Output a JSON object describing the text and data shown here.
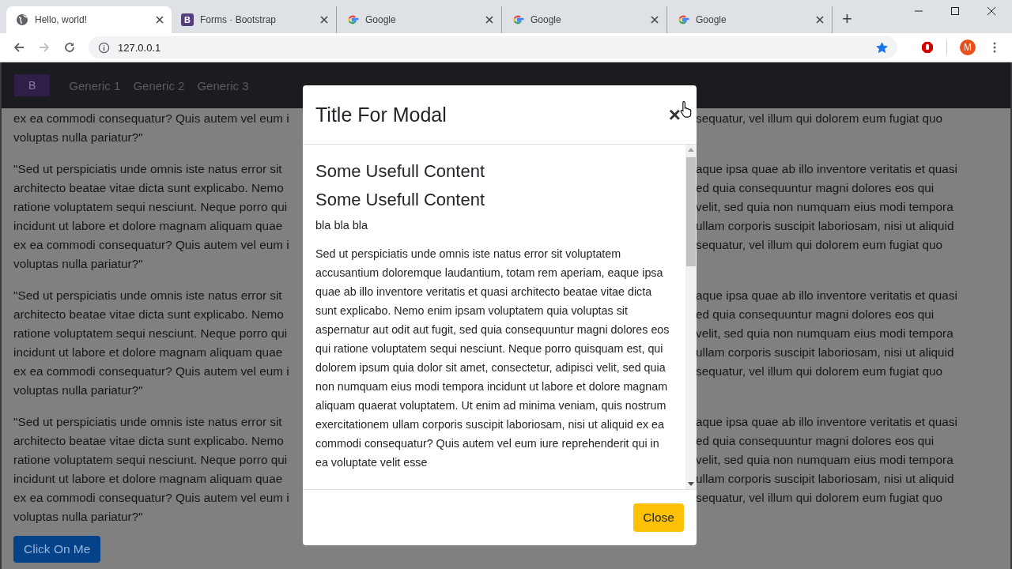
{
  "browser": {
    "tabs": [
      {
        "title": "Hello, world!",
        "kind": "globe",
        "selected": true
      },
      {
        "title": "Forms · Bootstrap",
        "kind": "letter",
        "icon_letter": "B",
        "selected": false
      },
      {
        "title": "Google",
        "kind": "google",
        "selected": false
      },
      {
        "title": "Google",
        "kind": "google",
        "selected": false
      },
      {
        "title": "Google",
        "kind": "google",
        "selected": false
      }
    ],
    "new_tab": "+",
    "address": "127.0.0.1",
    "bookmarked": true,
    "avatar": "M"
  },
  "navbar": {
    "brand": "B",
    "links": [
      "Generic 1",
      "Generic 2",
      "Generic 3"
    ]
  },
  "background": {
    "paragraphs": [
      {
        "lines": [
          {
            "left": "ex ea commodi consequatur? Quis autem vel eum i",
            "right": "sequatur, vel illum qui dolorem eum fugiat quo"
          },
          {
            "left": "voluptas nulla pariatur?\""
          }
        ]
      },
      {
        "lines": [
          {
            "left": "\"Sed ut perspiciatis unde omnis iste natus error sit",
            "right": "aque ipsa quae ab illo inventore veritatis et quasi"
          },
          {
            "left": "architecto beatae vitae dicta sunt explicabo. Nemo",
            "right": "ed quia consequuntur magni dolores eos qui"
          },
          {
            "left": "ratione voluptatem sequi nesciunt. Neque porro qui",
            "right": "velit, sed quia non numquam eius modi tempora"
          },
          {
            "left": "incidunt ut labore et dolore magnam aliquam quae",
            "right": "ullam corporis suscipit laboriosam, nisi ut aliquid"
          },
          {
            "left": "ex ea commodi consequatur? Quis autem vel eum i",
            "right": "sequatur, vel illum qui dolorem eum fugiat quo"
          },
          {
            "left": "voluptas nulla pariatur?\""
          }
        ]
      },
      {
        "lines": [
          {
            "left": "\"Sed ut perspiciatis unde omnis iste natus error sit",
            "right": "aque ipsa quae ab illo inventore veritatis et quasi"
          },
          {
            "left": "architecto beatae vitae dicta sunt explicabo. Nemo",
            "right": "ed quia consequuntur magni dolores eos qui"
          },
          {
            "left": "ratione voluptatem sequi nesciunt. Neque porro qui",
            "right": "velit, sed quia non numquam eius modi tempora"
          },
          {
            "left": "incidunt ut labore et dolore magnam aliquam quae",
            "right": "ullam corporis suscipit laboriosam, nisi ut aliquid"
          },
          {
            "left": "ex ea commodi consequatur? Quis autem vel eum i",
            "right": "sequatur, vel illum qui dolorem eum fugiat quo"
          },
          {
            "left": "voluptas nulla pariatur?\""
          }
        ]
      },
      {
        "lines": [
          {
            "left": "\"Sed ut perspiciatis unde omnis iste natus error sit",
            "right": "aque ipsa quae ab illo inventore veritatis et quasi"
          },
          {
            "left": "architecto beatae vitae dicta sunt explicabo. Nemo",
            "right": "ed quia consequuntur magni dolores eos qui"
          },
          {
            "left": "ratione voluptatem sequi nesciunt. Neque porro qui",
            "right": "velit, sed quia non numquam eius modi tempora"
          },
          {
            "left": "incidunt ut labore et dolore magnam aliquam quae",
            "right": "ullam corporis suscipit laboriosam, nisi ut aliquid"
          },
          {
            "left": "ex ea commodi consequatur? Quis autem vel eum i",
            "right": "sequatur, vel illum qui dolorem eum fugiat quo"
          },
          {
            "left": "voluptas nulla pariatur?\""
          }
        ]
      }
    ],
    "button": "Click On Me"
  },
  "modal": {
    "title": "Title For Modal",
    "close": "×",
    "headings": [
      "Some Usefull Content",
      "Some Usefull Content"
    ],
    "text": "bla bla bla",
    "paragraph": "Sed ut perspiciatis unde omnis iste natus error sit voluptatem accusantium doloremque laudantium, totam rem aperiam, eaque ipsa quae ab illo inventore veritatis et quasi architecto beatae vitae dicta sunt explicabo. Nemo enim ipsam voluptatem quia voluptas sit aspernatur aut odit aut fugit, sed quia consequuntur magni dolores eos qui ratione voluptatem sequi nesciunt. Neque porro quisquam est, qui dolorem ipsum quia dolor sit amet, consectetur, adipisci velit, sed quia non numquam eius modi tempora incidunt ut labore et dolore magnam aliquam quaerat voluptatem. Ut enim ad minima veniam, quis nostrum exercitationem ullam corporis suscipit laboriosam, nisi ut aliquid ex ea commodi consequatur? Quis autem vel eum iure reprehenderit qui in ea voluptate velit esse",
    "footer_button": "Close"
  }
}
